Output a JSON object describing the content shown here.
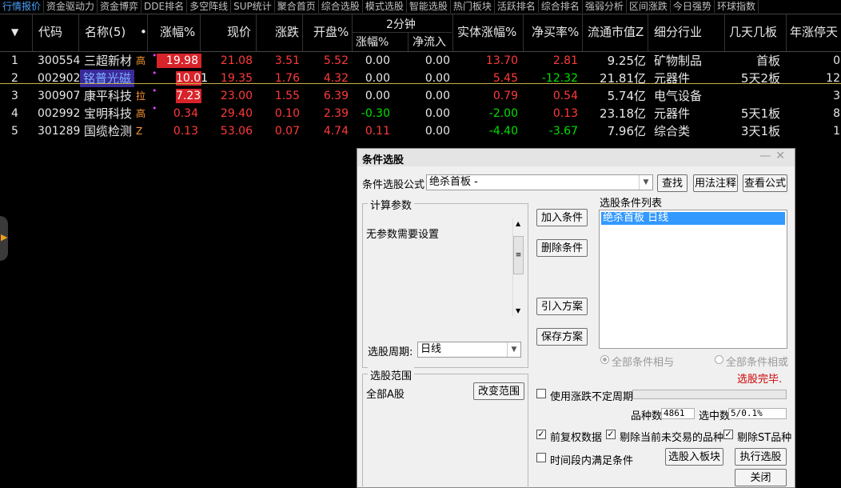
{
  "tabs": [
    "行情报价",
    "资金驱动力",
    "资金博弈",
    "DDE排名",
    "多空阵线",
    "SUP统计",
    "聚合首页",
    "综合选股",
    "模式选股",
    "智能选股",
    "热门板块",
    "活跃排名",
    "综合排名",
    "强弱分析",
    "区间涨跌",
    "今日强势",
    "环球指数"
  ],
  "table": {
    "headers": {
      "sort": "▼",
      "code": "代码",
      "name": "名称(5)",
      "dot": "•",
      "chg_pct": "涨幅%",
      "price": "现价",
      "change": "涨跌",
      "open_pct": "开盘%",
      "two_min": "2分钟",
      "two_min_pct": "涨幅%",
      "two_min_inflow": "净流入",
      "body_pct": "实体涨幅%",
      "net_buy": "净买率%",
      "float_cap": "流通市值Z",
      "industry": "细分行业",
      "days_boards": "几天几板",
      "year_limit": "年涨停天"
    },
    "rows": [
      {
        "idx": "1",
        "code": "300554",
        "name": "三超新材",
        "tag": "高",
        "chg": "19.98",
        "price": "21.08",
        "change": "3.51",
        "open": "5.52",
        "m2pct": "0.00",
        "m2in": "0.00",
        "body": "13.70",
        "netbuy": "2.81",
        "cap": "9.25亿",
        "industry": "矿物制品",
        "boards": "首板",
        "year": "0"
      },
      {
        "idx": "2",
        "code": "002902",
        "name": "铭普光磁",
        "tag": "",
        "chg": "10.01",
        "price": "19.35",
        "change": "1.76",
        "open": "4.32",
        "m2pct": "0.00",
        "m2in": "0.00",
        "body": "5.45",
        "netbuy": "-12.32",
        "cap": "21.81亿",
        "industry": "元器件",
        "boards": "5天2板",
        "year": "12"
      },
      {
        "idx": "3",
        "code": "300907",
        "name": "康平科技",
        "tag": "拉",
        "chg": "7.23",
        "price": "23.00",
        "change": "1.55",
        "open": "6.39",
        "m2pct": "0.00",
        "m2in": "0.00",
        "body": "0.79",
        "netbuy": "0.54",
        "cap": "5.74亿",
        "industry": "电气设备",
        "boards": "",
        "year": "3"
      },
      {
        "idx": "4",
        "code": "002992",
        "name": "宝明科技",
        "tag": "高",
        "chg": "0.34",
        "price": "29.40",
        "change": "0.10",
        "open": "2.39",
        "m2pct": "-0.30",
        "m2in": "0.00",
        "body": "-2.00",
        "netbuy": "0.13",
        "cap": "23.18亿",
        "industry": "元器件",
        "boards": "5天1板",
        "year": "8"
      },
      {
        "idx": "5",
        "code": "301289",
        "name": "国缆检测",
        "tag": "Z",
        "chg": "0.13",
        "price": "53.06",
        "change": "0.07",
        "open": "4.74",
        "m2pct": "0.11",
        "m2in": "0.00",
        "body": "-4.40",
        "netbuy": "-3.67",
        "cap": "7.96亿",
        "industry": "综合类",
        "boards": "3天1板",
        "year": "1"
      }
    ]
  },
  "dialog": {
    "title": "条件选股",
    "formula_label": "条件选股公式",
    "formula_value": "绝杀首板        -",
    "find_btn": "查找",
    "usage_btn": "用法注释",
    "view_btn": "查看公式",
    "params_title": "计算参数",
    "params_text": "无参数需要设置",
    "add_btn": "加入条件",
    "delete_btn": "删除条件",
    "import_btn": "引入方案",
    "save_btn": "保存方案",
    "list_title": "选股条件列表",
    "list_item": "绝杀首板   日线",
    "period_label": "选股周期:",
    "period_value": "日线",
    "radio_and": "全部条件相与",
    "radio_or": "全部条件相或",
    "status": "选股完毕.",
    "range_title": "选股范围",
    "range_value": "全部A股",
    "change_range_btn": "改变范围",
    "variable_period": "使用涨跌不定周期",
    "count_label": "品种数",
    "count_value": "4861",
    "selected_label": "选中数",
    "selected_value": "5/0.1%",
    "adj_label": "前复权数据",
    "exclude_untraded": "剔除当前未交易的品种",
    "exclude_st": "剔除ST品种",
    "period_satisfy": "时间段内满足条件",
    "to_block_btn": "选股入板块",
    "run_btn": "执行选股",
    "close_btn": "关闭",
    "colors": {
      "accent": "#3399ff",
      "status": "#cc0000"
    }
  }
}
